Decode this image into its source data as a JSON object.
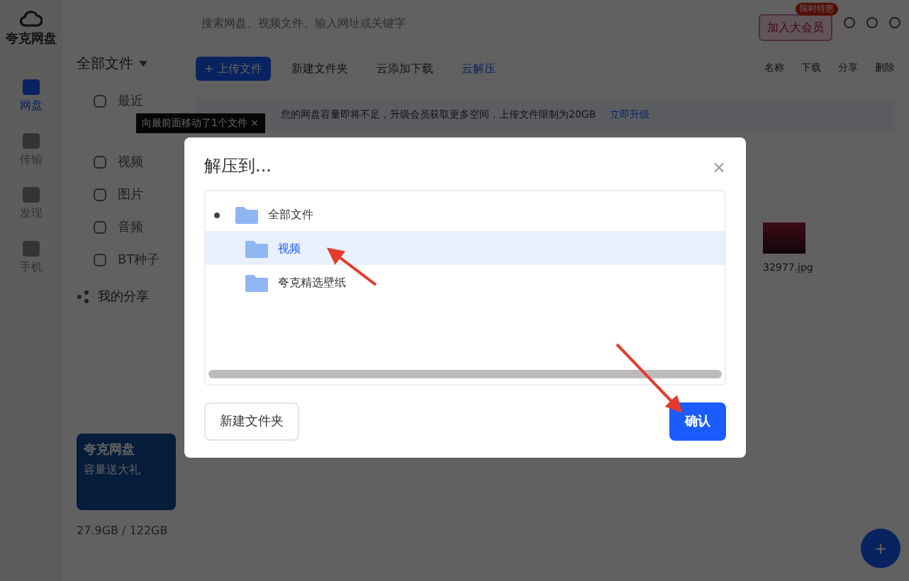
{
  "app": {
    "logo": "夸克网盘",
    "rail": [
      {
        "label": "网盘",
        "selected": true
      },
      {
        "label": "传输",
        "selected": false
      },
      {
        "label": "发现",
        "selected": false
      },
      {
        "label": "手机",
        "selected": false
      }
    ],
    "search": {
      "placeholder": "搜索网盘、视频文件、输入网址或关键字"
    },
    "promo": {
      "badge": "限时特惠",
      "button": "加入大会员"
    },
    "sidebar": {
      "root": "全部文件",
      "tooltip": "向最前面移动了1个文件 ×",
      "items": [
        {
          "label": "最近"
        },
        {
          "label": "视频"
        },
        {
          "label": "图片"
        },
        {
          "label": "音频"
        },
        {
          "label": "BT种子"
        }
      ],
      "share": "我的分享",
      "card": {
        "title": "夸克网盘",
        "subtitle": "容量送大礼"
      },
      "storage": "27.9GB / 122GB"
    },
    "toolbar": {
      "actions": [
        {
          "label": "+ 上传文件",
          "kind": "primary"
        },
        {
          "label": "新建文件夹",
          "kind": "plain"
        },
        {
          "label": "云添加下载",
          "kind": "plain"
        },
        {
          "label": "云解压",
          "kind": "link"
        }
      ],
      "right": [
        "名称",
        "下载",
        "分享",
        "删除"
      ]
    },
    "banner": {
      "text": "您的网盘容量即将不足，升级会员获取更多空间，上传文件限制为20GB",
      "link": "立即升级"
    },
    "file": {
      "name": "32977.jpg"
    },
    "fab": "+"
  },
  "dialog": {
    "title": "解压到...",
    "close": "×",
    "tree": [
      {
        "label": "全部文件",
        "expanded": true,
        "selected": false,
        "children": [
          {
            "label": "视频",
            "selected": true
          },
          {
            "label": "夸克精选壁纸",
            "selected": false
          }
        ]
      }
    ],
    "buttons": [
      {
        "label": "新建文件夹",
        "kind": "secondary"
      },
      {
        "label": "确认",
        "kind": "primary"
      }
    ]
  }
}
